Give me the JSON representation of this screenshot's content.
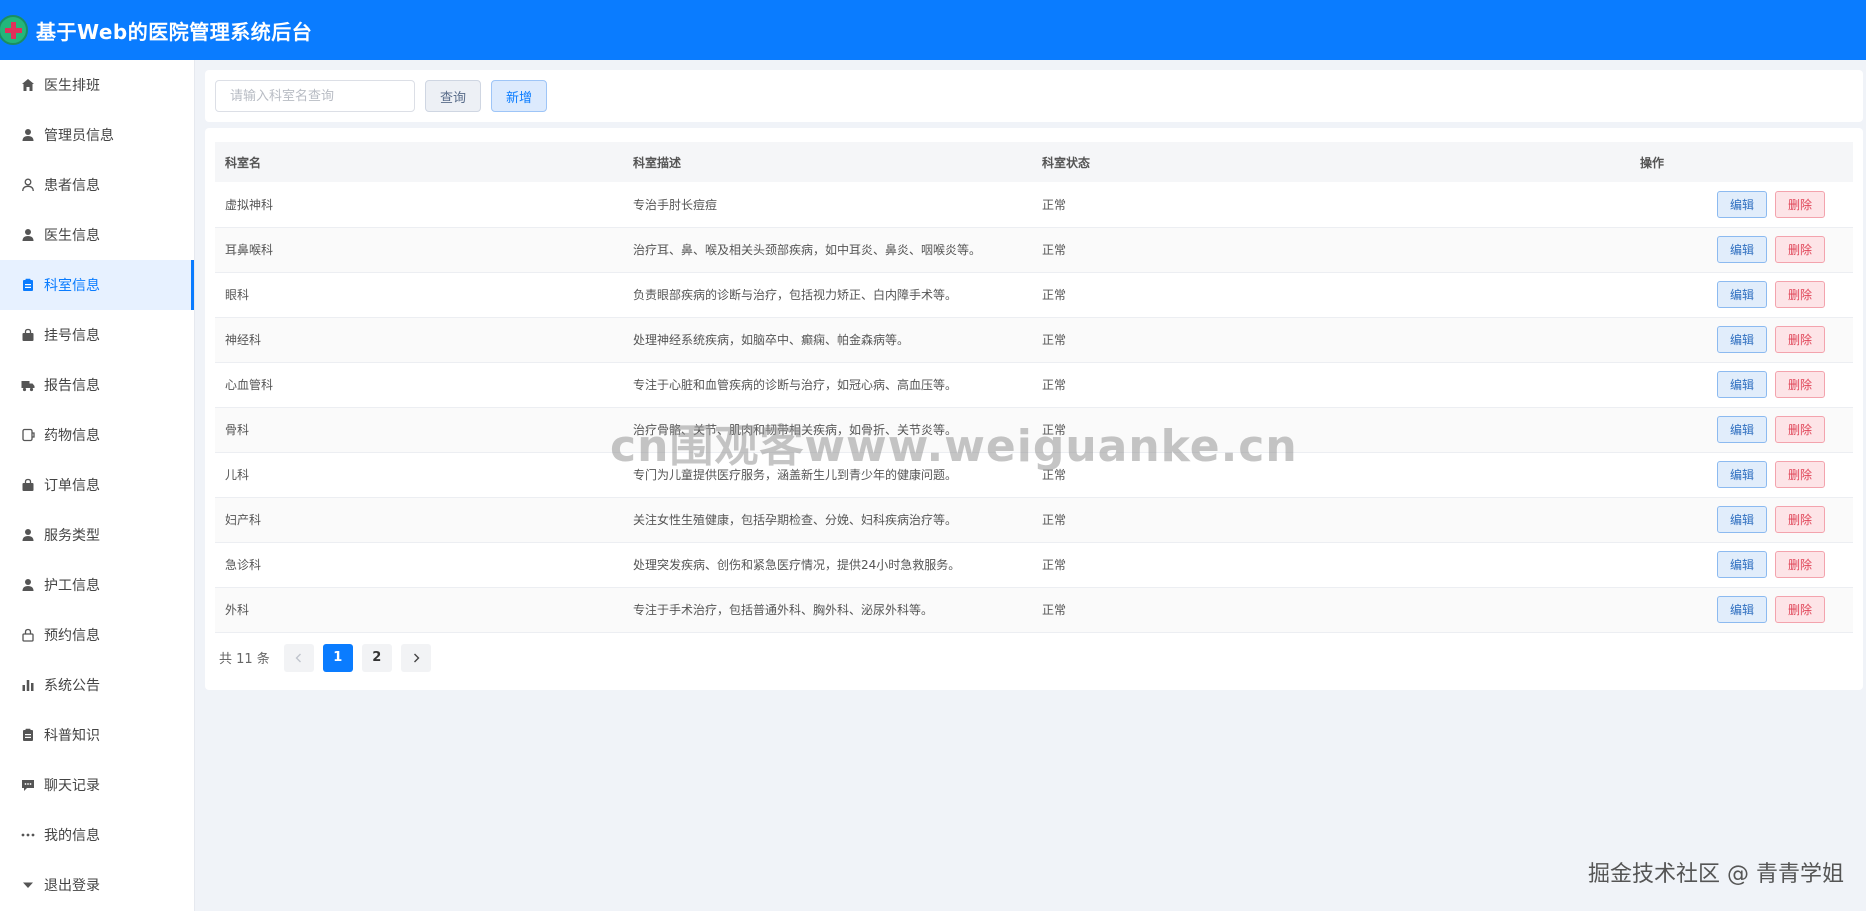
{
  "header": {
    "title": "基于Web的医院管理系统后台"
  },
  "sidebar": {
    "items": [
      {
        "label": "医生排班",
        "icon": "home-icon",
        "active": false
      },
      {
        "label": "管理员信息",
        "icon": "user-icon",
        "active": false
      },
      {
        "label": "患者信息",
        "icon": "user-outline-icon",
        "active": false
      },
      {
        "label": "医生信息",
        "icon": "user-icon",
        "active": false
      },
      {
        "label": "科室信息",
        "icon": "clipboard-icon",
        "active": true
      },
      {
        "label": "挂号信息",
        "icon": "bag-icon",
        "active": false
      },
      {
        "label": "报告信息",
        "icon": "truck-icon",
        "active": false
      },
      {
        "label": "药物信息",
        "icon": "document-icon",
        "active": false
      },
      {
        "label": "订单信息",
        "icon": "bag-icon",
        "active": false
      },
      {
        "label": "服务类型",
        "icon": "user-icon",
        "active": false
      },
      {
        "label": "护工信息",
        "icon": "user-icon",
        "active": false
      },
      {
        "label": "预约信息",
        "icon": "lock-icon",
        "active": false
      },
      {
        "label": "系统公告",
        "icon": "bar-chart-icon",
        "active": false
      },
      {
        "label": "科普知识",
        "icon": "clipboard-icon",
        "active": false
      },
      {
        "label": "聊天记录",
        "icon": "chat-icon",
        "active": false
      },
      {
        "label": "我的信息",
        "icon": "more-icon",
        "active": false
      },
      {
        "label": "退出登录",
        "icon": "caret-down-icon",
        "active": false
      }
    ]
  },
  "search": {
    "placeholder": "请输入科室名查询",
    "query_label": "查询",
    "add_label": "新增"
  },
  "table": {
    "columns": [
      "科室名",
      "科室描述",
      "科室状态",
      "操作"
    ],
    "edit_label": "编辑",
    "delete_label": "删除",
    "rows": [
      {
        "name": "虚拟神科",
        "desc": "专治手肘长痘痘",
        "status": "正常"
      },
      {
        "name": "耳鼻喉科",
        "desc": "治疗耳、鼻、喉及相关头颈部疾病，如中耳炎、鼻炎、咽喉炎等。",
        "status": "正常"
      },
      {
        "name": "眼科",
        "desc": "负责眼部疾病的诊断与治疗，包括视力矫正、白内障手术等。",
        "status": "正常"
      },
      {
        "name": "神经科",
        "desc": "处理神经系统疾病，如脑卒中、癫痫、帕金森病等。",
        "status": "正常"
      },
      {
        "name": "心血管科",
        "desc": "专注于心脏和血管疾病的诊断与治疗，如冠心病、高血压等。",
        "status": "正常"
      },
      {
        "name": "骨科",
        "desc": "治疗骨骼、关节、肌肉和韧带相关疾病，如骨折、关节炎等。",
        "status": "正常"
      },
      {
        "name": "儿科",
        "desc": "专门为儿童提供医疗服务，涵盖新生儿到青少年的健康问题。",
        "status": "正常"
      },
      {
        "name": "妇产科",
        "desc": "关注女性生殖健康，包括孕期检查、分娩、妇科疾病治疗等。",
        "status": "正常"
      },
      {
        "name": "急诊科",
        "desc": "处理突发疾病、创伤和紧急医疗情况，提供24小时急救服务。",
        "status": "正常"
      },
      {
        "name": "外科",
        "desc": "专注于手术治疗，包括普通外科、胸外科、泌尿外科等。",
        "status": "正常"
      }
    ]
  },
  "pagination": {
    "total_label": "共 11 条",
    "pages": [
      "1",
      "2"
    ],
    "current": "1"
  },
  "overlay": {
    "watermark": "cn围观客www.weiguanke.cn",
    "credit": "掘金技术社区 @ 青青学姐"
  }
}
